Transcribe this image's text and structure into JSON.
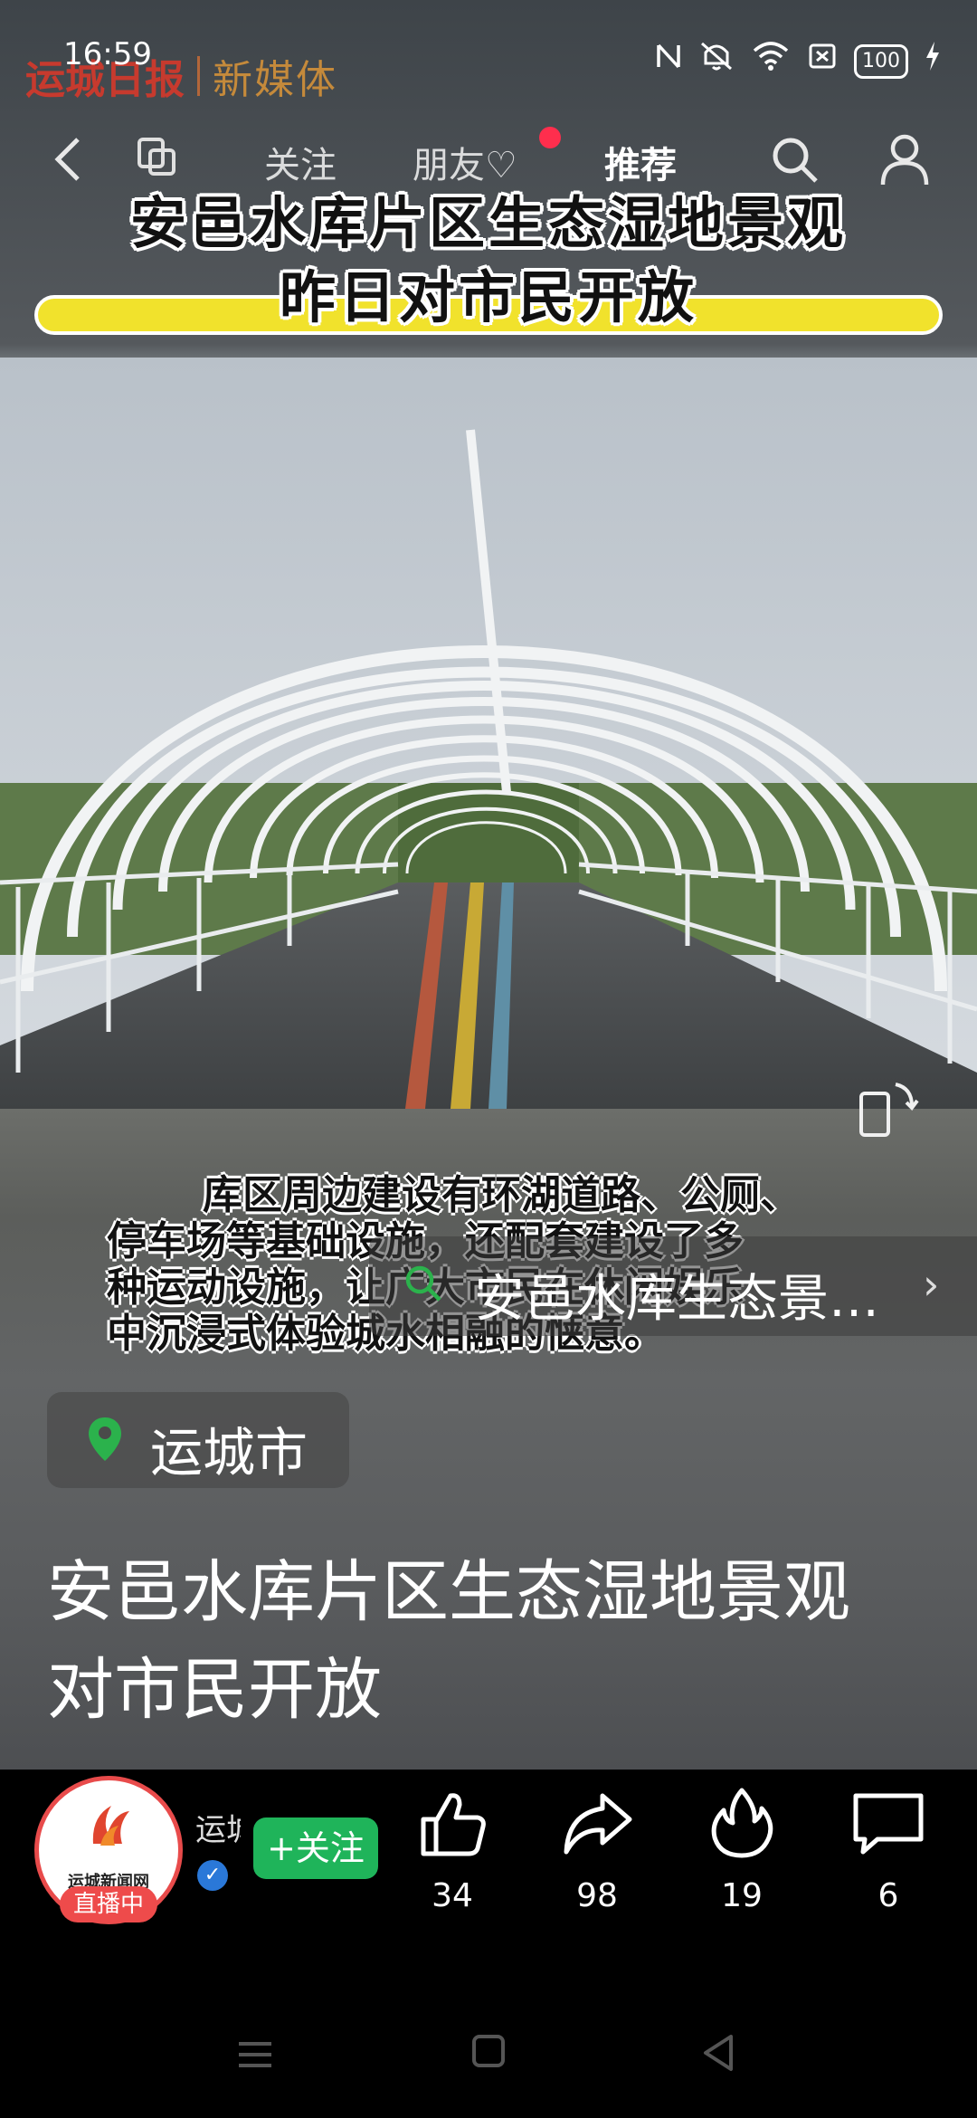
{
  "status_bar": {
    "time": "16:59",
    "battery": "100"
  },
  "watermark": {
    "brand": "运城日报",
    "suffix": "新媒体"
  },
  "nav": {
    "tabs": [
      {
        "label": "关注"
      },
      {
        "label": "朋友♡"
      },
      {
        "label": "推荐"
      }
    ],
    "active_tab": "推荐"
  },
  "video": {
    "headline_line1": "安邑水库片区生态湿地景观",
    "headline_line2": "昨日对市民开放",
    "caption_line1": "库区周边建设有环湖道路、公厕、",
    "caption_line2": "停车场等基础设施，还配套建设了多",
    "caption_line3": "种运动设施，让广大市民在休闲娱乐",
    "caption_line4": "中沉浸式体验城水相融的惬意。"
  },
  "search_suggestion": {
    "text": "安邑水库生态景…"
  },
  "location": {
    "label": "运城市"
  },
  "post": {
    "title_line1": "安邑水库片区生态湿地景观",
    "title_line2": "对市民开放"
  },
  "author": {
    "name": "运城",
    "avatar_brand": "运城新闻网",
    "live_badge": "直播中",
    "follow_label": "+关注"
  },
  "actions": {
    "like_count": "34",
    "share_count": "98",
    "hot_count": "19",
    "comment_count": "6"
  },
  "colors": {
    "follow_green": "#1fb45a",
    "live_red": "#ee4b4b",
    "headline_bar": "#f1e22c",
    "pin_green": "#2bb24c"
  }
}
